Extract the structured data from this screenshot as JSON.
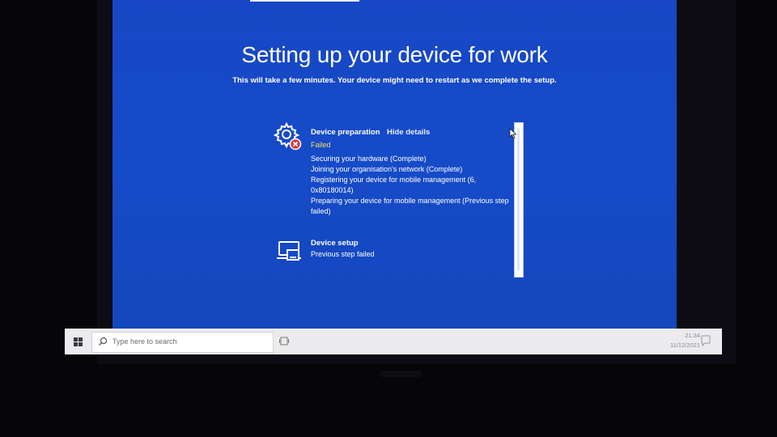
{
  "screen": {
    "title": "Setting up your device for work",
    "subtitle": "This will take a few minutes. Your device might need to restart as we complete the setup."
  },
  "steps": [
    {
      "title": "Device preparation",
      "link": "Hide details",
      "status": "Failed",
      "icon": "gear-error-icon",
      "details": [
        "Securing your hardware (Complete)",
        "Joining your organisation's network (Complete)",
        "Registering your device for mobile management (6, 0x80180014)",
        "Preparing your device for mobile management (Previous step failed)"
      ]
    },
    {
      "title": "Device setup",
      "status": "Previous step failed",
      "icon": "laptop-icon"
    }
  ],
  "taskbar": {
    "search_placeholder": "Type here to search",
    "time": "21:34",
    "date": "11/12/2021"
  },
  "colors": {
    "screen_blue": "#164bc8",
    "failed_status": "#f3e36a",
    "error_red": "#d83b3b",
    "taskbar": "#ececee"
  }
}
